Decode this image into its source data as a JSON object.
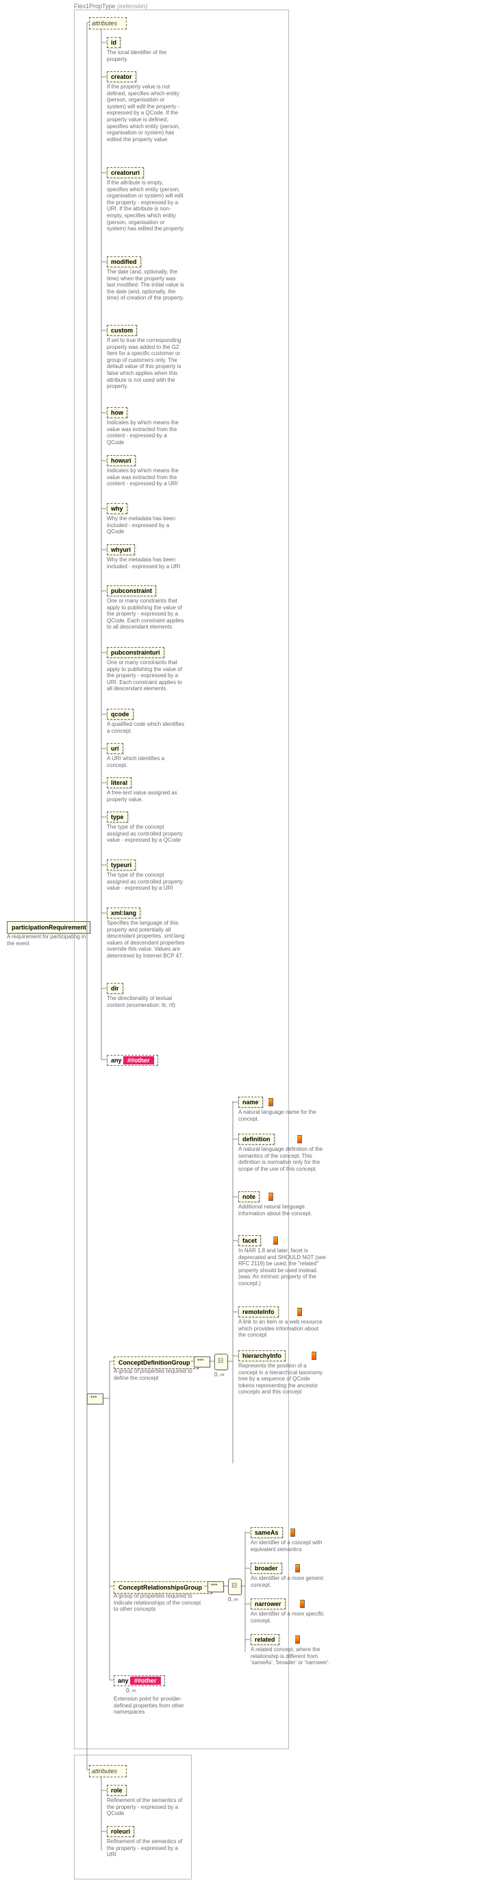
{
  "rootPrefix": "Flex1PropType ",
  "rootExt": "(extension)",
  "root": "participationRequirement",
  "rootDesc": "A requirement for participating in the event",
  "attrBox": "attributes",
  "cdg": "ConceptDefinitionGroup",
  "cdgDesc": "A group of properties required to define the concept",
  "crg": "ConceptRelationshipsGroup",
  "crgDesc": "A group of properties required to indicate relationships of the concept to other concepts",
  "anyBox": "any ",
  "anyOther": "##other",
  "anyDesc": "Extension point for provider-defined properties from other namespaces",
  "cardN": "0..∞",
  "attrs": [
    {
      "n": "id",
      "d": "The local identifier of the property."
    },
    {
      "n": "creator",
      "d": "If the property value is not defined, specifies which entity (person, organisation or system) will edit the property - expressed by a QCode. If the property value is defined, specifies which entity (person, organisation or system) has edited the property value."
    },
    {
      "n": "creatoruri",
      "d": "If the attribute is empty, specifies which entity (person, organisation or system) will edit the property - expressed by a URI. If the attribute is non-empty, specifies which entity (person, organisation or system) has edited the property."
    },
    {
      "n": "modified",
      "d": "The date (and, optionally, the time) when the property was last modified. The initial value is the date (and, optionally, the time) of creation of the property."
    },
    {
      "n": "custom",
      "d": "If set to true the corresponding property was added to the G2 Item for a specific customer or group of customers only. The default value of this property is false which applies when this attribute is not used with the property."
    },
    {
      "n": "how",
      "d": "Indicates by which means the value was extracted from the content - expressed by a QCode"
    },
    {
      "n": "howuri",
      "d": "Indicates by which means the value was extracted from the content - expressed by a URI"
    },
    {
      "n": "why",
      "d": "Why the metadata has been included - expressed by a QCode"
    },
    {
      "n": "whyuri",
      "d": "Why the metadata has been included - expressed by a URI"
    },
    {
      "n": "pubconstraint",
      "d": "One or many constraints that apply to publishing the value of the property - expressed by a QCode. Each constraint applies to all descendant elements."
    },
    {
      "n": "pubconstrainturi",
      "d": "One or many constraints that apply to publishing the value of the property - expressed by a URI. Each constraint applies to all descendant elements."
    },
    {
      "n": "qcode",
      "d": "A qualified code which identifies a concept."
    },
    {
      "n": "uri",
      "d": "A URI which identifies a concept."
    },
    {
      "n": "literal",
      "d": "A free-text value assigned as property value."
    },
    {
      "n": "type",
      "d": "The type of the concept assigned as controlled property value - expressed by a QCode"
    },
    {
      "n": "typeuri",
      "d": "The type of the concept assigned as controlled property value - expressed by a URI"
    },
    {
      "n": "xml:lang",
      "d": "Specifies the language of this property and potentially all descendant properties. xml:lang values of descendant properties override this value. Values are determined by Internet BCP 47."
    },
    {
      "n": "dir",
      "d": "The directionality of textual content (enumeration: ltr, rtl)"
    }
  ],
  "attrOtherBox": "any ",
  "attrOtherTag": "##other",
  "cdgChildren": [
    {
      "n": "name",
      "d": "A natural language name for the concept."
    },
    {
      "n": "definition",
      "d": "A natural language definition of the semantics of the concept. This definition is normative only for the scope of the use of this concept."
    },
    {
      "n": "note",
      "d": "Additional natural language information about the concept."
    },
    {
      "n": "facet",
      "d": "In NAR 1.8 and later, facet is deprecated and SHOULD NOT (see RFC 2119) be used, the \"related\" property should be used instead.(was: An intrinsic property of the concept.)"
    },
    {
      "n": "remoteInfo",
      "d": "A link to an item or a web resource which provides information about the concept"
    },
    {
      "n": "hierarchyInfo",
      "d": "Represents the position of a concept in a hierarchical taxonomy tree by a sequence of QCode tokens representing the ancestor concepts and this concept"
    }
  ],
  "crgChildren": [
    {
      "n": "sameAs",
      "d": "An identifier of a concept with equivalent semantics"
    },
    {
      "n": "broader",
      "d": "An identifier of a more generic concept."
    },
    {
      "n": "narrower",
      "d": "An identifier of a more specific concept."
    },
    {
      "n": "related",
      "d": "A related concept, where the relationship is different from 'sameAs', 'broader' or 'narrower'."
    }
  ],
  "attrs2": [
    {
      "n": "role",
      "d": "Refinement of the semantics of the property - expressed by a QCode"
    },
    {
      "n": "roleuri",
      "d": "Refinement of the semantics of the property - expressed by a URI"
    }
  ]
}
